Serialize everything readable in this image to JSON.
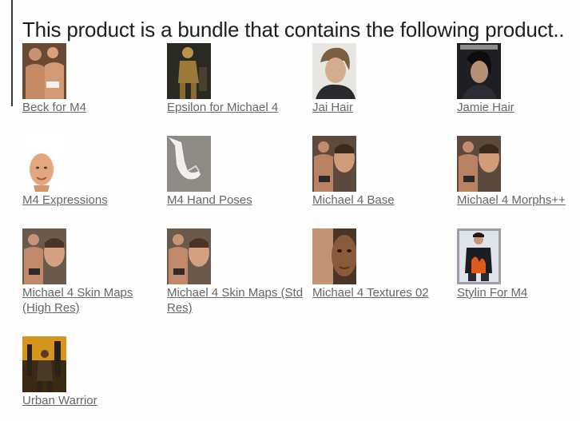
{
  "heading": "This product is a bundle that contains the following product..",
  "products": [
    {
      "name": "Beck for M4",
      "thumb_icon": "figure-thumbnail"
    },
    {
      "name": "Epsilon for Michael 4",
      "thumb_icon": "armor-figure-thumbnail"
    },
    {
      "name": "Jai Hair",
      "thumb_icon": "hair-portrait-thumbnail"
    },
    {
      "name": "Jamie Hair",
      "thumb_icon": "magazine-portrait-thumbnail"
    },
    {
      "name": "M4 Expressions",
      "thumb_icon": "bald-head-thumbnail"
    },
    {
      "name": "M4 Hand Poses",
      "thumb_icon": "hand-pose-thumbnail"
    },
    {
      "name": "Michael 4 Base",
      "thumb_icon": "figure-thumbnail"
    },
    {
      "name": "Michael 4 Morphs++",
      "thumb_icon": "figure-thumbnail"
    },
    {
      "name": "Michael 4 Skin Maps (High Res)",
      "thumb_icon": "figure-thumbnail"
    },
    {
      "name": "Michael 4 Skin Maps (Std Res)",
      "thumb_icon": "figure-thumbnail"
    },
    {
      "name": "Michael 4 Textures 02",
      "thumb_icon": "face-closeup-thumbnail"
    },
    {
      "name": "Stylin For M4",
      "thumb_icon": "clothing-stamp-thumbnail"
    },
    {
      "name": "Urban Warrior",
      "thumb_icon": "warrior-scene-thumbnail"
    }
  ]
}
